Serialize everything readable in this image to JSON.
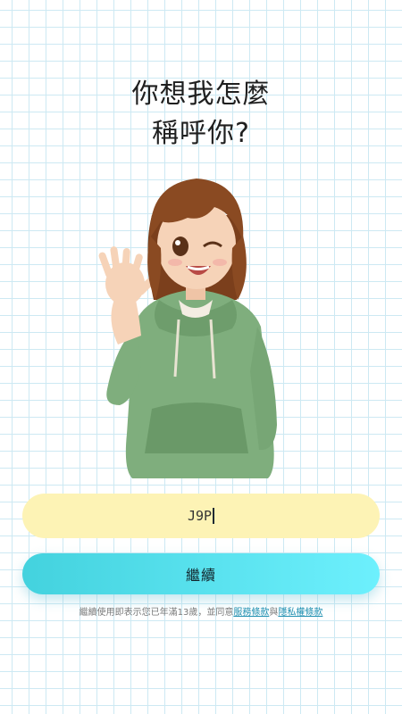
{
  "heading": {
    "line1": "你想我怎麼",
    "line2": "稱呼你?"
  },
  "avatar": {
    "icon": "waving-anime-girl-illustration",
    "colors": {
      "hair": "#8a4a22",
      "hoodie": "#7fae7d",
      "skin": "#f6d3b8"
    }
  },
  "name_input": {
    "value": "J9P"
  },
  "continue_button": {
    "label": "繼續"
  },
  "legal": {
    "prefix": "繼續使用即表示您已年滿13歲，並同意",
    "terms_link": "服務條款",
    "joiner": "與",
    "privacy_link": "隱私權條款"
  },
  "colors": {
    "input_bg": "#fdf3b5",
    "button_gradient_start": "#43d2de",
    "button_gradient_end": "#6df0fd",
    "link": "#1f8fb0",
    "grid_line": "#cde9f3"
  }
}
